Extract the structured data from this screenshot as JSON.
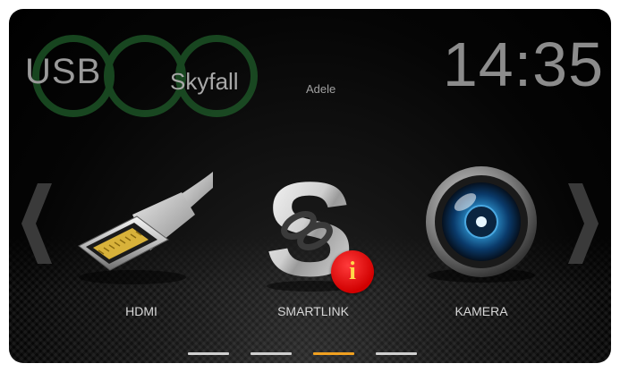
{
  "now_playing": {
    "source": "USB",
    "title": "Skyfall",
    "artist": "Adele"
  },
  "clock": "14:35",
  "apps": [
    {
      "label": "HDMI",
      "icon": "hdmi-plug-icon"
    },
    {
      "label": "SMARTLINK",
      "icon": "smartlink-icon",
      "badge": "i"
    },
    {
      "label": "KAMERA",
      "icon": "camera-lens-icon"
    }
  ],
  "navigation": {
    "left": "chevron-left-icon",
    "right": "chevron-right-icon"
  },
  "pagination": {
    "pages": 4,
    "active_index": 2
  },
  "colors": {
    "active_page": "#f0a020",
    "inactive_page": "#cfcfcf",
    "badge": "#e00000",
    "rings": "#1f5c2a"
  }
}
